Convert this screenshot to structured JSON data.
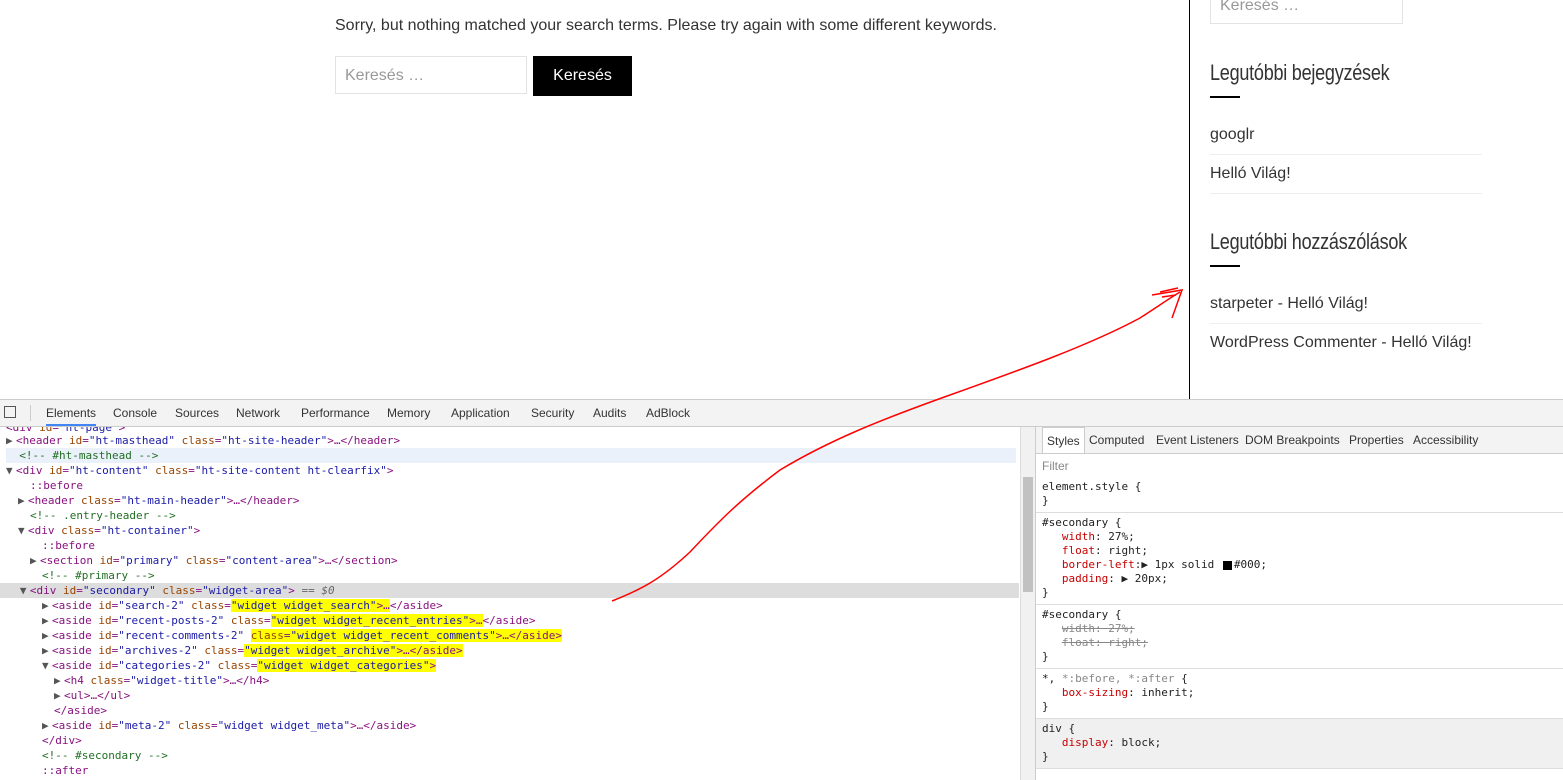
{
  "page": {
    "no_results": "Sorry, but nothing matched your search terms. Please try again with some different keywords.",
    "search_placeholder": "Keresés …",
    "search_button": "Keresés"
  },
  "sidebar": {
    "search_placeholder": "Keresés …",
    "recent_posts_title": "Legutóbbi bejegyzések",
    "recent_posts": [
      "googlr",
      "Helló Világ!"
    ],
    "recent_comments_title": "Legutóbbi hozzászólások",
    "recent_comments": [
      "starpeter - Helló Világ!",
      "WordPress Commenter - Helló Világ!"
    ]
  },
  "devtools": {
    "tabs": [
      "Elements",
      "Console",
      "Sources",
      "Network",
      "Performance",
      "Memory",
      "Application",
      "Security",
      "Audits",
      "AdBlock"
    ],
    "styles_tabs": [
      "Styles",
      "Computed",
      "Event Listeners",
      "DOM Breakpoints",
      "Properties",
      "Accessibility"
    ],
    "filter_placeholder": "Filter"
  },
  "colors": {
    "highlight": "#ffff00",
    "annotation": "#ff0000",
    "tag": "#881280",
    "attr_name": "#994500",
    "attr_value": "#1a1aa6",
    "comment": "#236e25"
  }
}
